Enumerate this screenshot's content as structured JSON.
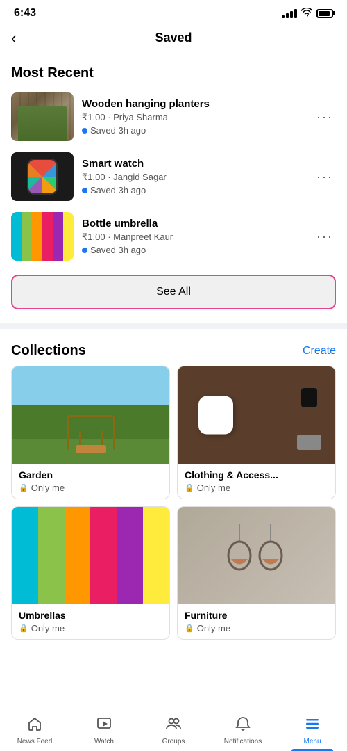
{
  "statusBar": {
    "time": "6:43"
  },
  "header": {
    "backLabel": "‹",
    "title": "Saved"
  },
  "mostRecent": {
    "sectionTitle": "Most Recent",
    "items": [
      {
        "title": "Wooden hanging planters",
        "price": "₹1.00",
        "seller": "Priya Sharma",
        "savedTime": "Saved 3h ago",
        "thumbType": "planter"
      },
      {
        "title": "Smart watch",
        "price": "₹1.00",
        "seller": "Jangid Sagar",
        "savedTime": "Saved 3h ago",
        "thumbType": "watch"
      },
      {
        "title": "Bottle umbrella",
        "price": "₹1.00",
        "seller": "Manpreet Kaur",
        "savedTime": "Saved 3h ago",
        "thumbType": "umbrella"
      }
    ],
    "seeAllLabel": "See All"
  },
  "collections": {
    "sectionTitle": "Collections",
    "createLabel": "Create",
    "items": [
      {
        "name": "Garden",
        "privacy": "Only me",
        "thumbType": "garden"
      },
      {
        "name": "Clothing & Access...",
        "privacy": "Only me",
        "thumbType": "accessories"
      },
      {
        "name": "Umbrellas",
        "privacy": "Only me",
        "thumbType": "umbrella-coll"
      },
      {
        "name": "Furniture",
        "privacy": "Only me",
        "thumbType": "chairs"
      }
    ]
  },
  "bottomNav": {
    "items": [
      {
        "label": "News Feed",
        "icon": "⌂",
        "active": false
      },
      {
        "label": "Watch",
        "icon": "▷",
        "active": false
      },
      {
        "label": "Groups",
        "icon": "⊕",
        "active": false
      },
      {
        "label": "Notifications",
        "icon": "🔔",
        "active": false
      },
      {
        "label": "Menu",
        "icon": "≡",
        "active": true
      }
    ]
  }
}
